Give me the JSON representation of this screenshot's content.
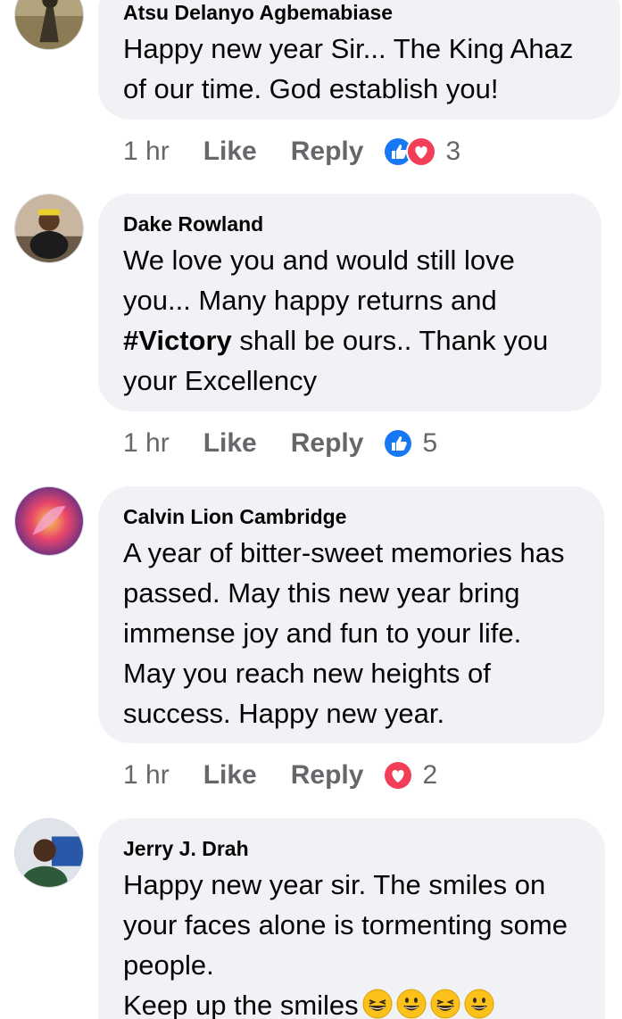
{
  "comments": [
    {
      "author": "Atsu Delanyo Agbemabiase",
      "text": "Happy new year Sir... The King Ahaz of our time. God establish you!",
      "time": "1 hr",
      "like_label": "Like",
      "reply_label": "Reply",
      "reactions": [
        "like",
        "love"
      ],
      "reaction_count": "3"
    },
    {
      "author": "Dake Rowland",
      "text_before": "We love you and would still love you... Many happy returns and ",
      "hashtag": "#Victory",
      "text_after": " shall be ours.. Thank you your Excellency",
      "time": "1 hr",
      "like_label": "Like",
      "reply_label": "Reply",
      "reactions": [
        "like"
      ],
      "reaction_count": "5"
    },
    {
      "author": "Calvin Lion Cambridge",
      "text": "A year of bitter-sweet memories has passed. May this new year bring immense joy and fun to your life. May you reach new heights of success. Happy new year.",
      "time": "1 hr",
      "like_label": "Like",
      "reply_label": "Reply",
      "reactions": [
        "love"
      ],
      "reaction_count": "2"
    },
    {
      "author": "Jerry J. Drah",
      "text_line1": "Happy new year sir. The smiles on your faces alone is tormenting some people.",
      "text_line2": "Keep up the smiles",
      "emojis": [
        "grinning-squinting-face",
        "grinning-face",
        "grinning-squinting-face",
        "grinning-face"
      ]
    }
  ],
  "colors": {
    "bubble": "#f0f2f5",
    "meta_text": "#65676b",
    "like_blue": "#1877f2",
    "love_red": "#f33e58"
  }
}
